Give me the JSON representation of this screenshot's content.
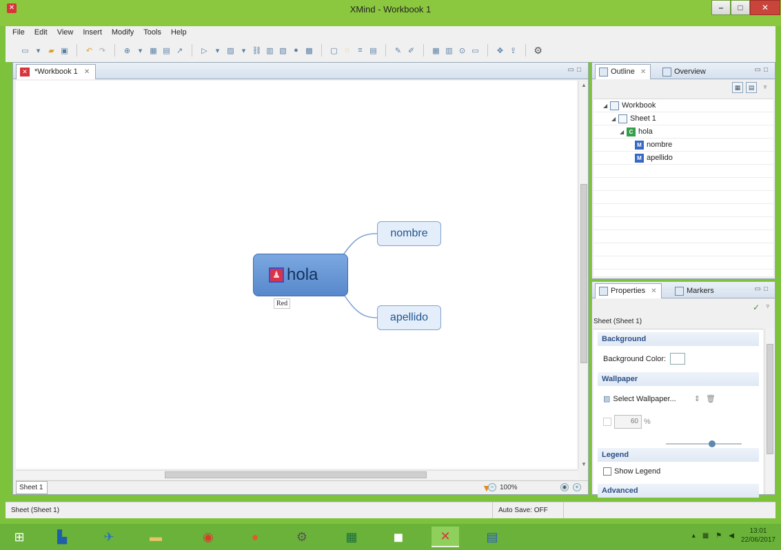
{
  "window": {
    "title": "XMind - Workbook 1"
  },
  "menu": [
    "File",
    "Edit",
    "View",
    "Insert",
    "Modify",
    "Tools",
    "Help"
  ],
  "editor": {
    "tab_label": "*Workbook 1",
    "sheet_tab": "Sheet 1",
    "zoom": "100%"
  },
  "map": {
    "central_topic": "hola",
    "subtopics": [
      "nombre",
      "apellido"
    ],
    "label": "Red"
  },
  "outline": {
    "tabs": [
      "Outline",
      "Overview"
    ],
    "tree": [
      {
        "label": "Workbook",
        "icon": "workbook-icon"
      },
      {
        "label": "Sheet 1",
        "icon": "sheet-icon"
      },
      {
        "label": "hola",
        "icon": "central-topic-icon",
        "glyph": "C"
      },
      {
        "label": "nombre",
        "icon": "main-topic-icon",
        "glyph": "M"
      },
      {
        "label": "apellido",
        "icon": "main-topic-icon",
        "glyph": "M"
      }
    ]
  },
  "properties": {
    "tabs": [
      "Properties",
      "Markers"
    ],
    "subject": "Sheet (Sheet 1)",
    "sections": {
      "background": "Background",
      "background_color_label": "Background Color:",
      "wallpaper": "Wallpaper",
      "select_wallpaper": "Select Wallpaper...",
      "opacity_value": "60",
      "opacity_unit": "%",
      "legend": "Legend",
      "show_legend": "Show Legend",
      "advanced": "Advanced"
    }
  },
  "status": {
    "left": "Sheet (Sheet 1)",
    "autosave": "Auto Save: OFF"
  },
  "taskbar": {
    "time": "13:01",
    "date": "22/06/2017"
  }
}
